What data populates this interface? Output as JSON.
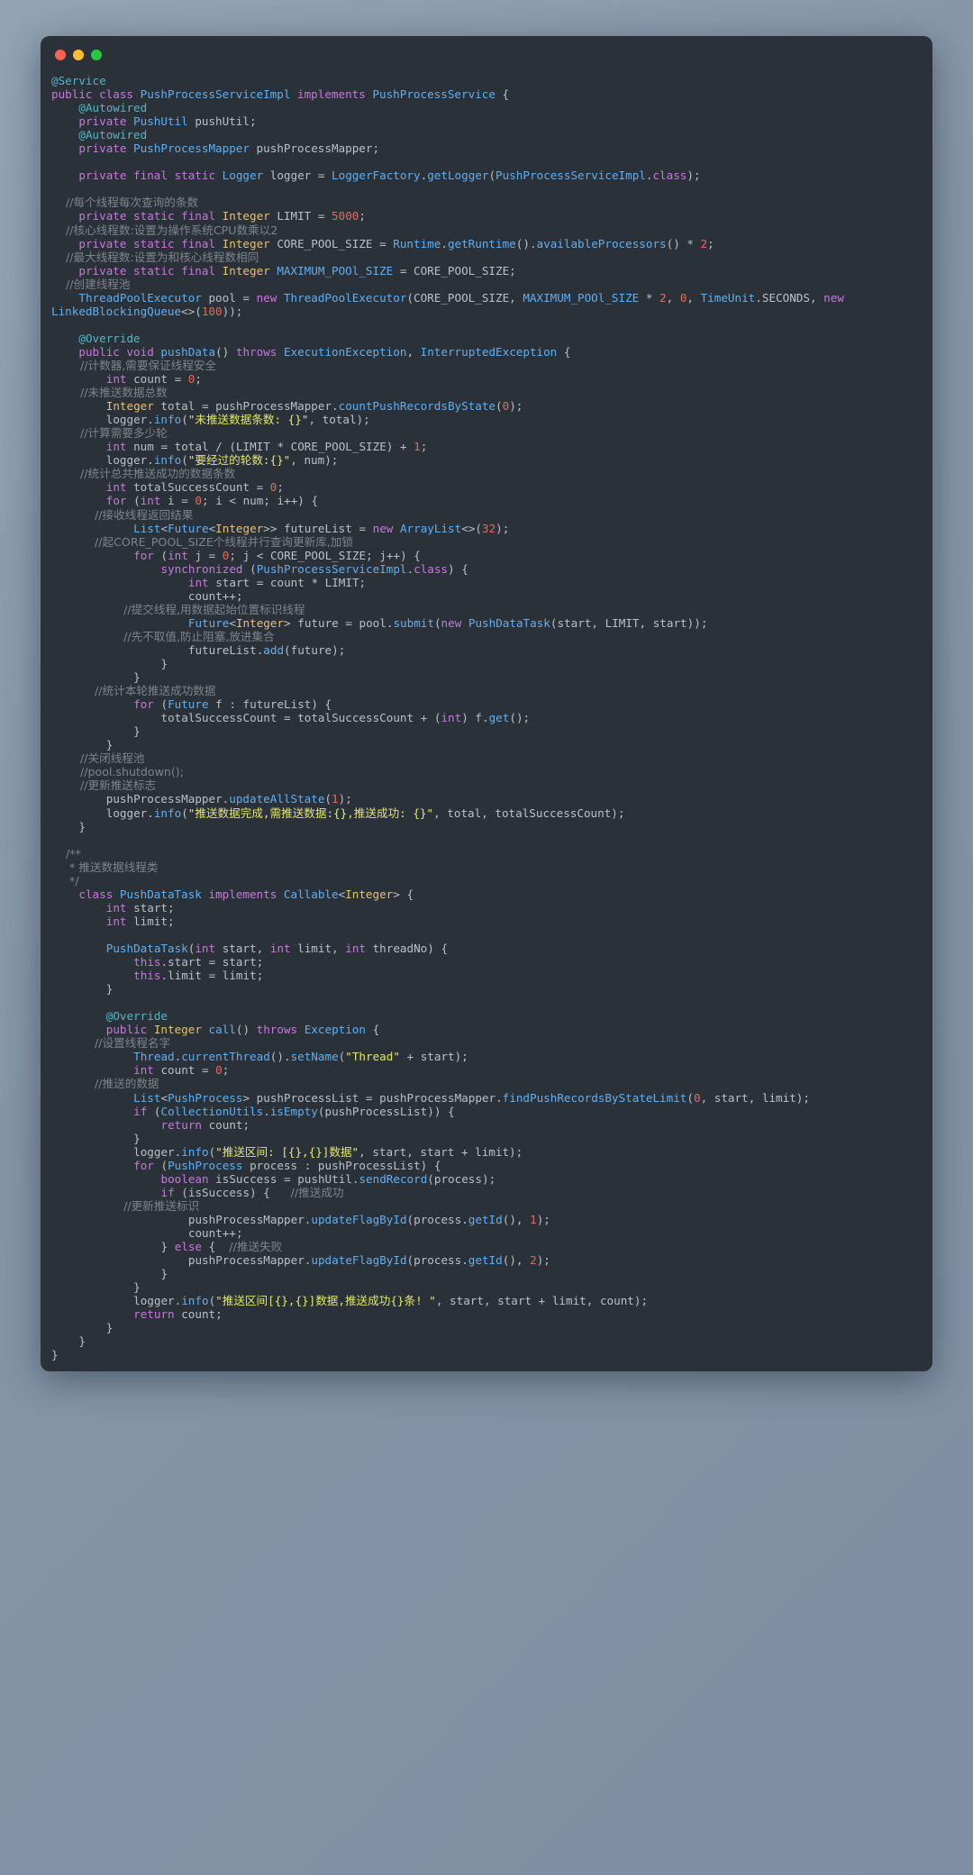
{
  "window": {
    "title_bar": {
      "buttons": [
        {
          "name": "close-button",
          "color": "#ff5f57"
        },
        {
          "name": "minimize-button",
          "color": "#febc2e"
        },
        {
          "name": "maximize-button",
          "color": "#28c840"
        }
      ]
    },
    "background_color": "#2b3138",
    "page_background_color": "#8595a8"
  },
  "theme": {
    "keyword": "#c678dd",
    "type": "#e5c07b",
    "class": "#61afef",
    "string": "#e2e86a",
    "number": "#e06c5f",
    "comment": "#7d848e",
    "annotation": "#56b6c2",
    "plain": "#b9c0ca"
  },
  "code": {
    "language": "java",
    "lines": [
      "@Service",
      "public class PushProcessServiceImpl implements PushProcessService {",
      "    @Autowired",
      "    private PushUtil pushUtil;",
      "    @Autowired",
      "    private PushProcessMapper pushProcessMapper;",
      "",
      "    private final static Logger logger = LoggerFactory.getLogger(PushProcessServiceImpl.class);",
      "",
      "    //每个线程每次查询的条数",
      "    private static final Integer LIMIT = 5000;",
      "    //核心线程数:设置为操作系统CPU数乘以2",
      "    private static final Integer CORE_POOL_SIZE = Runtime.getRuntime().availableProcessors() * 2;",
      "    //最大线程数:设置为和核心线程数相同",
      "    private static final Integer MAXIMUM_POOl_SIZE = CORE_POOL_SIZE;",
      "    //创建线程池",
      "    ThreadPoolExecutor pool = new ThreadPoolExecutor(CORE_POOL_SIZE, MAXIMUM_POOl_SIZE * 2, 0, TimeUnit.SECONDS, new LinkedBlockingQueue<>(100));",
      "",
      "    @Override",
      "    public void pushData() throws ExecutionException, InterruptedException {",
      "        //计数器,需要保证线程安全",
      "        int count = 0;",
      "        //未推送数据总数",
      "        Integer total = pushProcessMapper.countPushRecordsByState(0);",
      "        logger.info(\"未推送数据条数: {}\", total);",
      "        //计算需要多少轮",
      "        int num = total / (LIMIT * CORE_POOL_SIZE) + 1;",
      "        logger.info(\"要经过的轮数:{}\", num);",
      "        //统计总共推送成功的数据条数",
      "        int totalSuccessCount = 0;",
      "        for (int i = 0; i < num; i++) {",
      "            //接收线程返回结果",
      "            List<Future<Integer>> futureList = new ArrayList<>(32);",
      "            //起CORE_POOL_SIZE个线程并行查询更新库,加锁",
      "            for (int j = 0; j < CORE_POOL_SIZE; j++) {",
      "                synchronized (PushProcessServiceImpl.class) {",
      "                    int start = count * LIMIT;",
      "                    count++;",
      "                    //提交线程,用数据起始位置标识线程",
      "                    Future<Integer> future = pool.submit(new PushDataTask(start, LIMIT, start));",
      "                    //先不取值,防止阻塞,放进集合",
      "                    futureList.add(future);",
      "                }",
      "            }",
      "            //统计本轮推送成功数据",
      "            for (Future f : futureList) {",
      "                totalSuccessCount = totalSuccessCount + (int) f.get();",
      "            }",
      "        }",
      "        //关闭线程池",
      "        //pool.shutdown();",
      "        //更新推送标志",
      "        pushProcessMapper.updateAllState(1);",
      "        logger.info(\"推送数据完成,需推送数据:{},推送成功: {}\", total, totalSuccessCount);",
      "    }",
      "",
      "    /**",
      "     * 推送数据线程类",
      "     */",
      "    class PushDataTask implements Callable<Integer> {",
      "        int start;",
      "        int limit;",
      "",
      "        PushDataTask(int start, int limit, int threadNo) {",
      "            this.start = start;",
      "            this.limit = limit;",
      "        }",
      "",
      "        @Override",
      "        public Integer call() throws Exception {",
      "            //设置线程名字",
      "            Thread.currentThread().setName(\"Thread\" + start);",
      "            int count = 0;",
      "            //推送的数据",
      "            List<PushProcess> pushProcessList = pushProcessMapper.findPushRecordsByStateLimit(0, start, limit);",
      "            if (CollectionUtils.isEmpty(pushProcessList)) {",
      "                return count;",
      "            }",
      "            logger.info(\"推送区间: [{},{}]数据\", start, start + limit);",
      "            for (PushProcess process : pushProcessList) {",
      "                boolean isSuccess = pushUtil.sendRecord(process);",
      "                if (isSuccess) {   //推送成功",
      "                    //更新推送标识",
      "                    pushProcessMapper.updateFlagById(process.getId(), 1);",
      "                    count++;",
      "                } else {  //推送失败",
      "                    pushProcessMapper.updateFlagById(process.getId(), 2);",
      "                }",
      "            }",
      "            logger.info(\"推送区间[{},{}]数据,推送成功{}条! \", start, start + limit, count);",
      "            return count;",
      "        }",
      "    }",
      "}"
    ]
  }
}
